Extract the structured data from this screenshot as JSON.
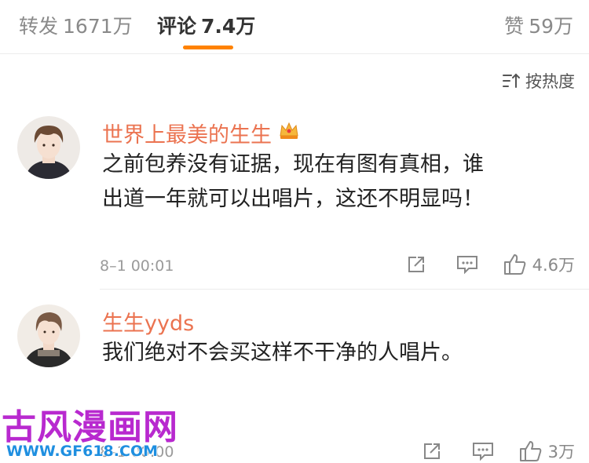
{
  "tabs": {
    "reposts": {
      "label": "转发",
      "count": "1671万"
    },
    "comments": {
      "label": "评论",
      "count": "7.4万"
    },
    "likes": {
      "label": "赞",
      "count": "59万"
    }
  },
  "sort": {
    "label": "按热度"
  },
  "comments": [
    {
      "username": "世界上最美的生生",
      "badge": "crown-icon",
      "text_line1": "之前包养没有证据，现在有图有真相，谁",
      "text_line2": "出道一年就可以出唱片，这还不明显吗！",
      "time": "8–1 00:01",
      "likes": "4.6万"
    },
    {
      "username": "生生yyds",
      "text_line1": "我们绝对不会买这样不干净的人唱片。",
      "time": "8–1 00:00",
      "likes": "3万"
    }
  ],
  "watermark": {
    "title": "古风漫画网",
    "url": "WWW.GF618.COM"
  },
  "colors": {
    "accent": "#ff8200",
    "username": "#eb7350",
    "watermark_title": "#b829cf",
    "watermark_url": "#1f8fe0"
  }
}
